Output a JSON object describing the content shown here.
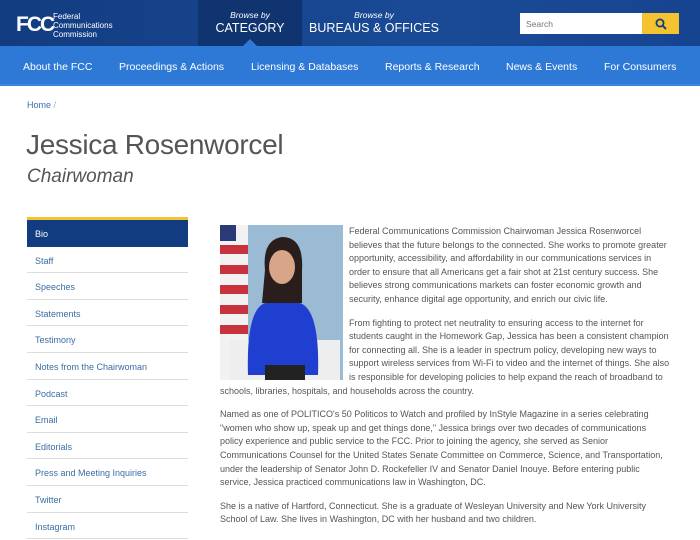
{
  "header": {
    "logo": "FCC",
    "agency_lines": [
      "Federal",
      "Communications",
      "Commission"
    ],
    "browse_category": {
      "small": "Browse by",
      "big": "CATEGORY"
    },
    "browse_bureaus": {
      "small": "Browse by",
      "big": "BUREAUS & OFFICES"
    },
    "search_placeholder": "Search"
  },
  "nav": [
    "About the FCC",
    "Proceedings & Actions",
    "Licensing & Databases",
    "Reports & Research",
    "News & Events",
    "For Consumers"
  ],
  "breadcrumb": {
    "home": "Home",
    "sep": "/"
  },
  "page": {
    "name": "Jessica Rosenworcel",
    "title": "Chairwoman"
  },
  "sidebar": [
    "Bio",
    "Staff",
    "Speeches",
    "Statements",
    "Testimony",
    "Notes from the Chairwoman",
    "Podcast",
    "Email",
    "Editorials",
    "Press and Meeting Inquiries",
    "Twitter",
    "Instagram"
  ],
  "bio": [
    "Federal Communications Commission Chairwoman Jessica Rosenworcel believes that the future belongs to the connected. She works to promote greater opportunity, accessibility, and affordability in our communications services in order to ensure that all Americans get a fair shot at 21st century success. She believes strong communications markets can foster economic growth and security, enhance digital age opportunity, and enrich our civic life.",
    "From fighting to protect net neutrality to ensuring access to the internet for students caught in the Homework Gap, Jessica has been a consistent champion for connecting all. She is a leader in spectrum policy, developing new ways to support wireless services from Wi-Fi to video and the internet of things. She also is responsible for developing policies to help expand the reach of broadband to schools, libraries, hospitals, and households across the country.",
    "Named as one of POLITICO's 50 Politicos to Watch and profiled by InStyle Magazine in a series celebrating \"women who show up, speak up and get things done,\" Jessica brings over two decades of communications policy experience and public service to the FCC. Prior to joining the agency, she served as Senior Communications Counsel for the United States Senate Committee on Commerce, Science, and Transportation, under the leadership of Senator John D. Rockefeller IV and Senator Daniel Inouye. Before entering public service, Jessica practiced communications law in Washington, DC.",
    "She is a native of Hartford, Connecticut. She is a graduate of Wesleyan University and New York University School of Law. She lives in Washington, DC with her husband and two children."
  ]
}
